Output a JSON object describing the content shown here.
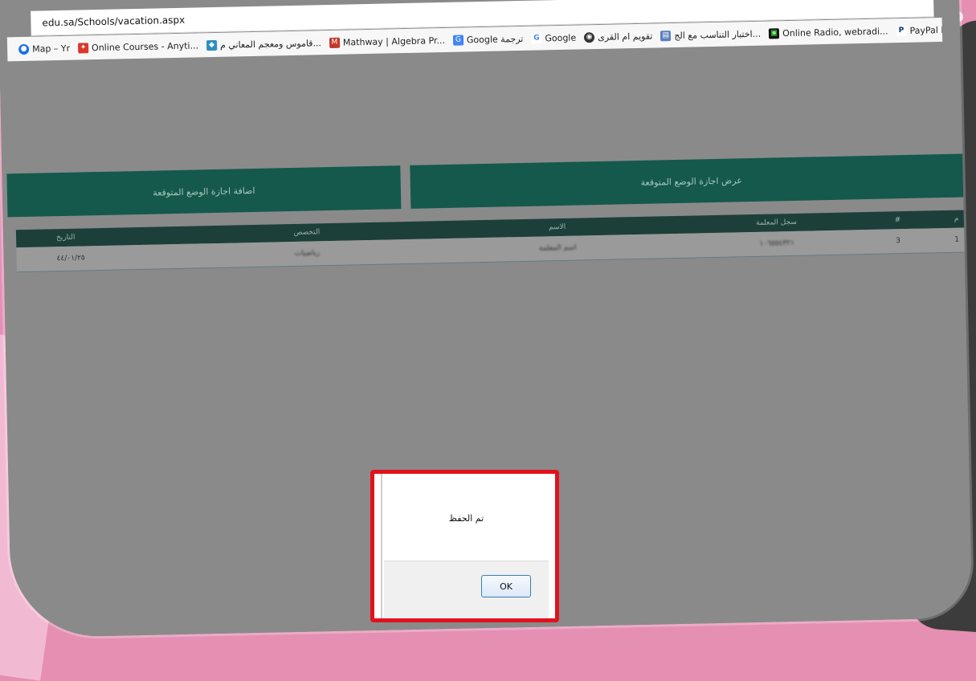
{
  "browser": {
    "url": "edu.sa/Schools/vacation.aspx",
    "bookmarks": [
      {
        "label": "Map – Yr",
        "icon": "globe-icon",
        "color": "#1a73e8"
      },
      {
        "label": "Online Courses - Anyti...",
        "icon": "online-courses-icon",
        "color": "#d9382b"
      },
      {
        "label": "قاموس ومعجم المعاني م...",
        "icon": "dictionary-icon",
        "color": "#2e8fbf"
      },
      {
        "label": "Mathway | Algebra Pr...",
        "icon": "mathway-icon",
        "color": "#c0392b"
      },
      {
        "label": "Google ترجمة",
        "icon": "translate-icon",
        "color": "#4285f4"
      },
      {
        "label": "Google",
        "icon": "google-icon",
        "color": "#4285f4"
      },
      {
        "label": "تقويم ام القرى",
        "icon": "calendar-globe-icon",
        "color": "#333333"
      },
      {
        "label": "اختبار التناسب مع الج...",
        "icon": "test-icon",
        "color": "#5b7fbf"
      },
      {
        "label": "Online Radio, webradi...",
        "icon": "radio-icon",
        "color": "#111111"
      },
      {
        "label": "PayPal Developer Doc...",
        "icon": "paypal-icon",
        "color": "#003087"
      }
    ]
  },
  "page": {
    "add_button": "اضافة اجازة الوضع المتوقعة",
    "view_button": "عرض اجازة الوضع المتوقعة",
    "table": {
      "headers": {
        "date": "التاريخ",
        "specialty": "التخصص",
        "name": "الاسم",
        "registry": "سجل المعلمة",
        "number": "#",
        "index": "م"
      },
      "rows": [
        {
          "date": "٤٤/٠١/٢٥",
          "specialty": "رياضيات",
          "name": "اسم المعلمة",
          "registry": "١٠٦٥٥٤٣٢١",
          "number": "3",
          "index": "1"
        }
      ]
    }
  },
  "dialog": {
    "message": "تم الحفظ",
    "ok_label": "OK"
  },
  "colors": {
    "accent": "#14594c",
    "header": "#1d3f3a",
    "highlight": "#e1121c",
    "background": "#e58fb3"
  }
}
